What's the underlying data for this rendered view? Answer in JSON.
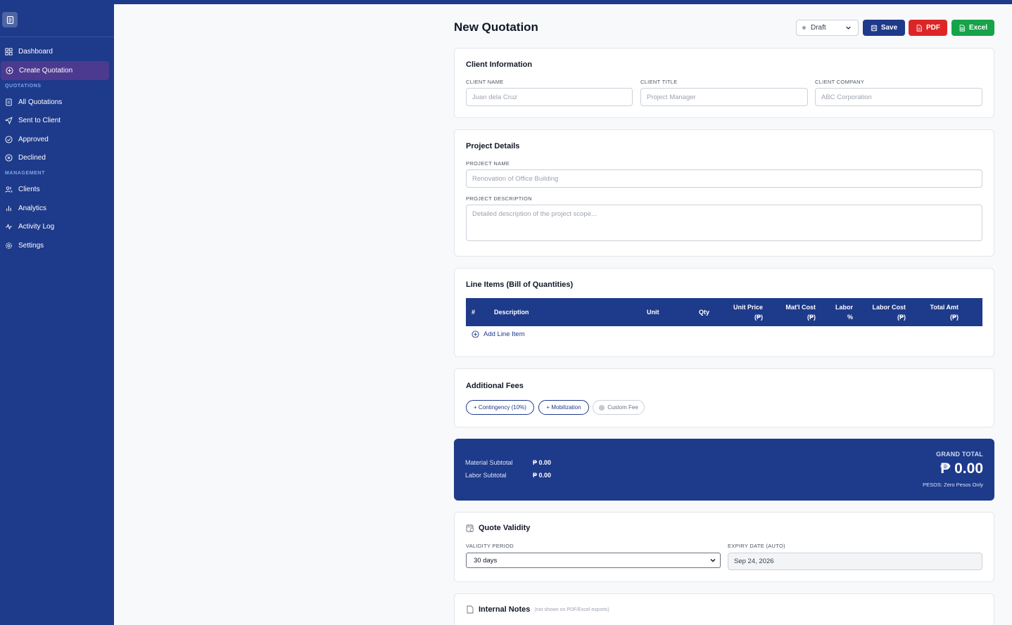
{
  "colors": {
    "brand": "#1e3a8a",
    "danger": "#dc2626",
    "success": "#16a34a",
    "active_nav": "#4b3a8f"
  },
  "sidebar": {
    "logo_icon": "document-icon",
    "items": [
      {
        "label": "Dashboard",
        "icon": "grid-icon"
      },
      {
        "label": "Create Quotation",
        "icon": "plus-circle-icon",
        "active": true
      }
    ],
    "section_quotations": "QUOTATIONS",
    "quotation_items": [
      {
        "label": "All Quotations",
        "icon": "document-icon"
      },
      {
        "label": "Sent to Client",
        "icon": "send-icon"
      },
      {
        "label": "Approved",
        "icon": "check-circle-icon"
      },
      {
        "label": "Declined",
        "icon": "x-circle-icon"
      }
    ],
    "section_management": "MANAGEMENT",
    "management_items": [
      {
        "label": "Clients",
        "icon": "users-icon"
      },
      {
        "label": "Analytics",
        "icon": "bar-chart-icon"
      },
      {
        "label": "Activity Log",
        "icon": "activity-icon"
      },
      {
        "label": "Settings",
        "icon": "gear-icon"
      }
    ]
  },
  "header": {
    "title": "New Quotation",
    "status": "Draft",
    "save_label": "Save",
    "pdf_label": "PDF",
    "excel_label": "Excel"
  },
  "client": {
    "title": "Client Information",
    "name_label": "CLIENT NAME",
    "name_placeholder": "Juan dela Cruz",
    "title_label": "CLIENT TITLE",
    "title_placeholder": "Project Manager",
    "company_label": "CLIENT COMPANY",
    "company_placeholder": "ABC Corporation"
  },
  "project": {
    "title": "Project Details",
    "name_label": "PROJECT NAME",
    "name_placeholder": "Renovation of Office Building",
    "desc_label": "PROJECT DESCRIPTION",
    "desc_placeholder": "Detailed description of the project scope..."
  },
  "line_items": {
    "title": "Line Items (Bill of Quantities)",
    "columns": {
      "num": "#",
      "description": "Description",
      "unit": "Unit",
      "qty": "Qty",
      "unit_price_1": "Unit Price",
      "unit_price_2": "(₱)",
      "mat_cost_1": "Mat'l Cost",
      "mat_cost_2": "(₱)",
      "labor_1": "Labor",
      "labor_2": "%",
      "labor_cost_1": "Labor Cost",
      "labor_cost_2": "(₱)",
      "total_1": "Total Amt",
      "total_2": "(₱)"
    },
    "add_label": "Add Line Item"
  },
  "fees": {
    "title": "Additional Fees",
    "contingency": "+ Contingency (10%)",
    "mobilization": "+ Mobilization",
    "custom": "Custom Fee"
  },
  "totals": {
    "material_label": "Material Subtotal",
    "material_value": "₱ 0.00",
    "labor_label": "Labor Subtotal",
    "labor_value": "₱ 0.00",
    "grand_label": "GRAND TOTAL",
    "grand_value": "₱ 0.00",
    "words": "PESOS: Zero Pesos Only"
  },
  "validity": {
    "title": "Quote Validity",
    "period_label": "VALIDITY PERIOD",
    "period_value": "30 days",
    "expiry_label": "EXPIRY DATE (AUTO)",
    "expiry_value": "Sep 24, 2026"
  },
  "notes": {
    "title": "Internal Notes",
    "subtitle": "(not shown on PDF/Excel exports)"
  }
}
